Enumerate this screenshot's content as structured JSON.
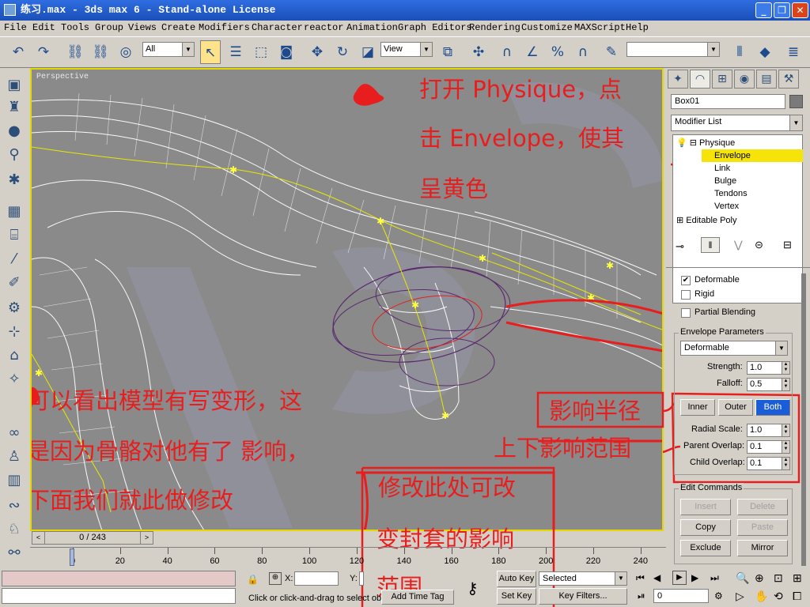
{
  "window": {
    "title": "练习.max - 3ds max 6 - Stand-alone License",
    "minimize": "_",
    "maximize": "❐",
    "close": "✕"
  },
  "menu": [
    "File",
    "Edit",
    "Tools",
    "Group",
    "Views",
    "Create",
    "Modifiers",
    "Character",
    "reactor",
    "Animation",
    "Graph Editors",
    "Rendering",
    "Customize",
    "MAXScript",
    "Help"
  ],
  "toolbar": {
    "selection_filter": "All",
    "ref_coord": "View",
    "named_selection": ""
  },
  "viewport": {
    "label": "Perspective"
  },
  "annotations": {
    "top_1": "打开 Physique，点",
    "top_2": "击 Envelope，使其",
    "top_3": "呈黄色",
    "left_1": "可以看出模型有写变形，这",
    "left_2": "是因为骨骼对他有了 影响，",
    "left_3": "下面我们就此做修改",
    "radius": "影响半径",
    "range": "上下影响范围",
    "bottom_1": "修改此处可改",
    "bottom_2": "变封套的影响",
    "bottom_3": "范围"
  },
  "command_panel": {
    "object_name": "Box01",
    "modifier_list": "Modifier List",
    "stack": [
      "Physique",
      "Envelope",
      "Link",
      "Bulge",
      "Tendons",
      "Vertex",
      "Editable Poly"
    ],
    "deformable": "Deformable",
    "rigid": "Rigid",
    "partial_blending": "Partial Blending",
    "envelope_parameters": "Envelope Parameters",
    "type_select": "Deformable",
    "strength_label": "Strength:",
    "strength": "1.0",
    "falloff_label": "Falloff:",
    "falloff": "0.5",
    "inner": "Inner",
    "outer": "Outer",
    "both": "Both",
    "radial_scale_label": "Radial Scale:",
    "radial_scale": "1.0",
    "parent_overlap_label": "Parent Overlap:",
    "parent_overlap": "0.1",
    "child_overlap_label": "Child Overlap:",
    "child_overlap": "0.1",
    "edit_commands": "Edit Commands",
    "insert": "Insert",
    "delete": "Delete",
    "copy": "Copy",
    "paste": "Paste",
    "exclude": "Exclude",
    "mirror": "Mirror"
  },
  "timeline": {
    "frame": "0 / 243",
    "ticks": [
      "0",
      "20",
      "40",
      "60",
      "80",
      "100",
      "120",
      "140",
      "160",
      "180",
      "200",
      "220",
      "240"
    ]
  },
  "status": {
    "x_label": "X:",
    "y_label": "Y:",
    "prompt": "Click or click-and-drag to select obj",
    "add_time_tag": "Add Time Tag",
    "auto_key": "Auto Key",
    "set_key": "Set Key",
    "key_mode": "Selected",
    "key_filters": "Key Filters...",
    "current_frame": "0"
  }
}
